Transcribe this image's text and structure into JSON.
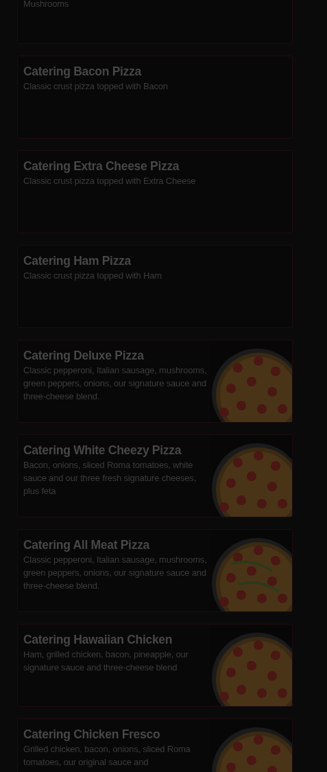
{
  "items": [
    {
      "description": "Mushrooms"
    },
    {
      "name": "Catering Bacon Pizza",
      "description": "Classic crust pizza topped with Bacon"
    },
    {
      "name": "Catering Extra Cheese Pizza",
      "description": "Classic crust pizza topped with Extra Cheese"
    },
    {
      "name": "Catering Ham Pizza",
      "description": "Classic crust pizza topped with Ham"
    },
    {
      "name": "Catering Deluxe Pizza",
      "description": "Classic pepperoni, Italian sausage, mushrooms, green peppers, onions, our signature sauce and three-cheese blend."
    },
    {
      "name": "Catering White Cheezy Pizza",
      "description": "Bacon, onions, sliced Roma tomatoes, white sauce and our three fresh signature cheeses, plus feta"
    },
    {
      "name": "Catering All Meat Pizza",
      "description": "Classic pepperoni, Italian sausage, mushrooms, green peppers, onions, our signature sauce and three-cheese blend."
    },
    {
      "name": "Catering Hawaiian Chicken",
      "description": "Ham, grilled chicken, bacon, pineapple, our signature sauce and three-cheese blend"
    },
    {
      "name": "Catering Chicken Fresco",
      "description": "Grilled chicken, bacon, onions, sliced Roma tomatoes, our original sauce and"
    }
  ]
}
